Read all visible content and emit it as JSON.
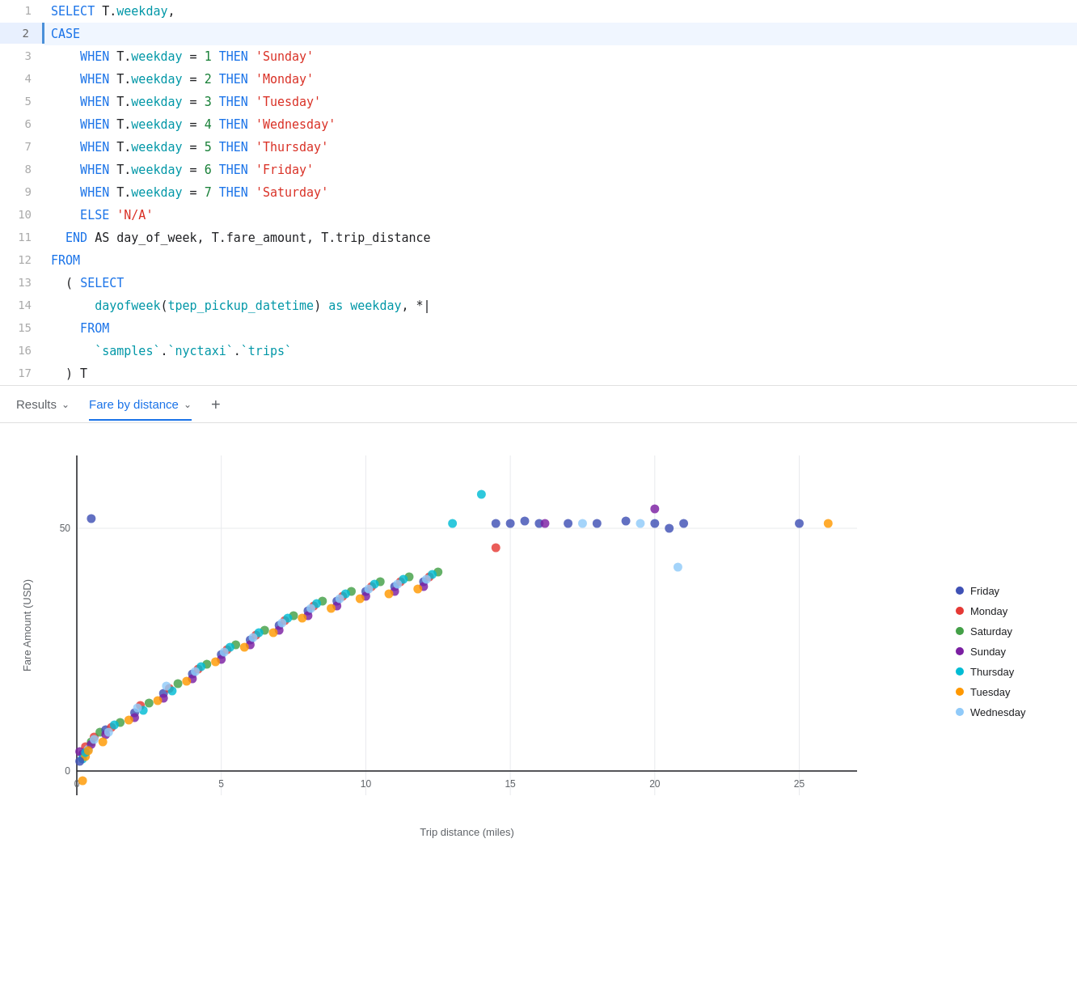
{
  "editor": {
    "lines": [
      {
        "num": 1,
        "active": false,
        "tokens": [
          {
            "text": "SELECT ",
            "cls": "kw-blue"
          },
          {
            "text": "T.",
            "cls": "kw-black"
          },
          {
            "text": "weekday",
            "cls": "kw-cyan"
          },
          {
            "text": ",",
            "cls": "kw-black"
          }
        ]
      },
      {
        "num": 2,
        "active": true,
        "tokens": [
          {
            "text": "CASE",
            "cls": "kw-blue"
          }
        ]
      },
      {
        "num": 3,
        "active": false,
        "tokens": [
          {
            "text": "    WHEN ",
            "cls": "kw-blue"
          },
          {
            "text": "T.",
            "cls": "kw-black"
          },
          {
            "text": "weekday",
            "cls": "kw-cyan"
          },
          {
            "text": " = ",
            "cls": "kw-black"
          },
          {
            "text": "1",
            "cls": "kw-green"
          },
          {
            "text": " THEN ",
            "cls": "kw-blue"
          },
          {
            "text": "'Sunday'",
            "cls": "kw-red"
          }
        ]
      },
      {
        "num": 4,
        "active": false,
        "tokens": [
          {
            "text": "    WHEN ",
            "cls": "kw-blue"
          },
          {
            "text": "T.",
            "cls": "kw-black"
          },
          {
            "text": "weekday",
            "cls": "kw-cyan"
          },
          {
            "text": " = ",
            "cls": "kw-black"
          },
          {
            "text": "2",
            "cls": "kw-green"
          },
          {
            "text": " THEN ",
            "cls": "kw-blue"
          },
          {
            "text": "'Monday'",
            "cls": "kw-red"
          }
        ]
      },
      {
        "num": 5,
        "active": false,
        "tokens": [
          {
            "text": "    WHEN ",
            "cls": "kw-blue"
          },
          {
            "text": "T.",
            "cls": "kw-black"
          },
          {
            "text": "weekday",
            "cls": "kw-cyan"
          },
          {
            "text": " = ",
            "cls": "kw-black"
          },
          {
            "text": "3",
            "cls": "kw-green"
          },
          {
            "text": " THEN ",
            "cls": "kw-blue"
          },
          {
            "text": "'Tuesday'",
            "cls": "kw-red"
          }
        ]
      },
      {
        "num": 6,
        "active": false,
        "tokens": [
          {
            "text": "    WHEN ",
            "cls": "kw-blue"
          },
          {
            "text": "T.",
            "cls": "kw-black"
          },
          {
            "text": "weekday",
            "cls": "kw-cyan"
          },
          {
            "text": " = ",
            "cls": "kw-black"
          },
          {
            "text": "4",
            "cls": "kw-green"
          },
          {
            "text": " THEN ",
            "cls": "kw-blue"
          },
          {
            "text": "'Wednesday'",
            "cls": "kw-red"
          }
        ]
      },
      {
        "num": 7,
        "active": false,
        "tokens": [
          {
            "text": "    WHEN ",
            "cls": "kw-blue"
          },
          {
            "text": "T.",
            "cls": "kw-black"
          },
          {
            "text": "weekday",
            "cls": "kw-cyan"
          },
          {
            "text": " = ",
            "cls": "kw-black"
          },
          {
            "text": "5",
            "cls": "kw-green"
          },
          {
            "text": " THEN ",
            "cls": "kw-blue"
          },
          {
            "text": "'Thursday'",
            "cls": "kw-red"
          }
        ]
      },
      {
        "num": 8,
        "active": false,
        "tokens": [
          {
            "text": "    WHEN ",
            "cls": "kw-blue"
          },
          {
            "text": "T.",
            "cls": "kw-black"
          },
          {
            "text": "weekday",
            "cls": "kw-cyan"
          },
          {
            "text": " = ",
            "cls": "kw-black"
          },
          {
            "text": "6",
            "cls": "kw-green"
          },
          {
            "text": " THEN ",
            "cls": "kw-blue"
          },
          {
            "text": "'Friday'",
            "cls": "kw-red"
          }
        ]
      },
      {
        "num": 9,
        "active": false,
        "tokens": [
          {
            "text": "    WHEN ",
            "cls": "kw-blue"
          },
          {
            "text": "T.",
            "cls": "kw-black"
          },
          {
            "text": "weekday",
            "cls": "kw-cyan"
          },
          {
            "text": " = ",
            "cls": "kw-black"
          },
          {
            "text": "7",
            "cls": "kw-green"
          },
          {
            "text": " THEN ",
            "cls": "kw-blue"
          },
          {
            "text": "'Saturday'",
            "cls": "kw-red"
          }
        ]
      },
      {
        "num": 10,
        "active": false,
        "tokens": [
          {
            "text": "    ELSE ",
            "cls": "kw-blue"
          },
          {
            "text": "'N/A'",
            "cls": "kw-red"
          }
        ]
      },
      {
        "num": 11,
        "active": false,
        "tokens": [
          {
            "text": "  END ",
            "cls": "kw-blue"
          },
          {
            "text": "AS ",
            "cls": "kw-black"
          },
          {
            "text": "day_of_week, T.fare_amount, T.trip_distance",
            "cls": "kw-black"
          }
        ]
      },
      {
        "num": 12,
        "active": false,
        "tokens": [
          {
            "text": "FROM",
            "cls": "kw-blue"
          }
        ]
      },
      {
        "num": 13,
        "active": false,
        "tokens": [
          {
            "text": "  ( ",
            "cls": "kw-black"
          },
          {
            "text": "SELECT",
            "cls": "kw-blue"
          }
        ]
      },
      {
        "num": 14,
        "active": false,
        "tokens": [
          {
            "text": "      ",
            "cls": "kw-black"
          },
          {
            "text": "dayofweek",
            "cls": "kw-cyan"
          },
          {
            "text": "(",
            "cls": "kw-black"
          },
          {
            "text": "tpep_pickup_datetime",
            "cls": "kw-cyan"
          },
          {
            "text": ") ",
            "cls": "kw-black"
          },
          {
            "text": "as ",
            "cls": "kw-cyan"
          },
          {
            "text": "weekday",
            "cls": "kw-cyan"
          },
          {
            "text": ", *",
            "cls": "kw-black"
          },
          {
            "text": "|",
            "cls": "kw-black"
          }
        ]
      },
      {
        "num": 15,
        "active": false,
        "tokens": [
          {
            "text": "    FROM",
            "cls": "kw-blue"
          }
        ]
      },
      {
        "num": 16,
        "active": false,
        "tokens": [
          {
            "text": "      ",
            "cls": "kw-black"
          },
          {
            "text": "`samples`",
            "cls": "kw-cyan"
          },
          {
            "text": ".",
            "cls": "kw-black"
          },
          {
            "text": "`nyctaxi`",
            "cls": "kw-cyan"
          },
          {
            "text": ".",
            "cls": "kw-black"
          },
          {
            "text": "`trips`",
            "cls": "kw-cyan"
          }
        ]
      },
      {
        "num": 17,
        "active": false,
        "tokens": [
          {
            "text": "  ) T",
            "cls": "kw-black"
          }
        ]
      }
    ]
  },
  "tabs": {
    "results_label": "Results",
    "fare_by_distance_label": "Fare by distance",
    "add_label": "+"
  },
  "chart": {
    "y_axis_label": "Fare Amount (USD)",
    "x_axis_label": "Trip distance (miles)",
    "y_ticks": [
      "0",
      "50"
    ],
    "x_ticks": [
      "0",
      "5",
      "10",
      "15",
      "20",
      "25"
    ],
    "legend": [
      {
        "label": "Friday",
        "color": "#3f51b5"
      },
      {
        "label": "Monday",
        "color": "#e53935"
      },
      {
        "label": "Saturday",
        "color": "#43a047"
      },
      {
        "label": "Sunday",
        "color": "#7b1fa2"
      },
      {
        "label": "Thursday",
        "color": "#00bcd4"
      },
      {
        "label": "Tuesday",
        "color": "#ff9800"
      },
      {
        "label": "Wednesday",
        "color": "#90caf9"
      }
    ],
    "scatter_points": [
      {
        "x": 0.2,
        "y": 3.5,
        "day": "Friday"
      },
      {
        "x": 0.3,
        "y": 5.0,
        "day": "Monday"
      },
      {
        "x": 0.5,
        "y": 6.0,
        "day": "Saturday"
      },
      {
        "x": 0.1,
        "y": 4.0,
        "day": "Sunday"
      },
      {
        "x": 0.2,
        "y": 2.5,
        "day": "Thursday"
      },
      {
        "x": 0.3,
        "y": 3.0,
        "day": "Tuesday"
      },
      {
        "x": 0.4,
        "y": 4.5,
        "day": "Wednesday"
      },
      {
        "x": 0.1,
        "y": 2.0,
        "day": "Friday"
      },
      {
        "x": 0.6,
        "y": 7.0,
        "day": "Monday"
      },
      {
        "x": 0.8,
        "y": 8.0,
        "day": "Saturday"
      },
      {
        "x": 0.5,
        "y": 5.5,
        "day": "Sunday"
      },
      {
        "x": 0.3,
        "y": 3.8,
        "day": "Thursday"
      },
      {
        "x": 0.4,
        "y": 4.2,
        "day": "Tuesday"
      },
      {
        "x": 0.6,
        "y": 6.5,
        "day": "Wednesday"
      },
      {
        "x": 1.0,
        "y": 8.5,
        "day": "Friday"
      },
      {
        "x": 1.2,
        "y": 9.0,
        "day": "Monday"
      },
      {
        "x": 1.5,
        "y": 10.0,
        "day": "Saturday"
      },
      {
        "x": 1.0,
        "y": 7.5,
        "day": "Sunday"
      },
      {
        "x": 1.3,
        "y": 9.5,
        "day": "Thursday"
      },
      {
        "x": 0.9,
        "y": 6.0,
        "day": "Tuesday"
      },
      {
        "x": 1.1,
        "y": 8.0,
        "day": "Wednesday"
      },
      {
        "x": 0.5,
        "y": 52,
        "day": "Friday"
      },
      {
        "x": 0.2,
        "y": -2,
        "day": "Tuesday"
      },
      {
        "x": 2.0,
        "y": 12.0,
        "day": "Friday"
      },
      {
        "x": 2.2,
        "y": 13.5,
        "day": "Monday"
      },
      {
        "x": 2.5,
        "y": 14.0,
        "day": "Saturday"
      },
      {
        "x": 2.0,
        "y": 11.0,
        "day": "Sunday"
      },
      {
        "x": 2.3,
        "y": 12.5,
        "day": "Thursday"
      },
      {
        "x": 1.8,
        "y": 10.5,
        "day": "Tuesday"
      },
      {
        "x": 2.1,
        "y": 13.0,
        "day": "Wednesday"
      },
      {
        "x": 3.0,
        "y": 16.0,
        "day": "Friday"
      },
      {
        "x": 3.2,
        "y": 17.0,
        "day": "Monday"
      },
      {
        "x": 3.5,
        "y": 18.0,
        "day": "Saturday"
      },
      {
        "x": 3.0,
        "y": 15.0,
        "day": "Sunday"
      },
      {
        "x": 3.3,
        "y": 16.5,
        "day": "Thursday"
      },
      {
        "x": 2.8,
        "y": 14.5,
        "day": "Tuesday"
      },
      {
        "x": 3.1,
        "y": 17.5,
        "day": "Wednesday"
      },
      {
        "x": 4.0,
        "y": 20.0,
        "day": "Friday"
      },
      {
        "x": 4.2,
        "y": 21.0,
        "day": "Monday"
      },
      {
        "x": 4.5,
        "y": 22.0,
        "day": "Saturday"
      },
      {
        "x": 4.0,
        "y": 19.0,
        "day": "Sunday"
      },
      {
        "x": 4.3,
        "y": 21.5,
        "day": "Thursday"
      },
      {
        "x": 3.8,
        "y": 18.5,
        "day": "Tuesday"
      },
      {
        "x": 4.1,
        "y": 20.5,
        "day": "Wednesday"
      },
      {
        "x": 5.0,
        "y": 24.0,
        "day": "Friday"
      },
      {
        "x": 5.2,
        "y": 25.0,
        "day": "Monday"
      },
      {
        "x": 5.5,
        "y": 26.0,
        "day": "Saturday"
      },
      {
        "x": 5.0,
        "y": 23.0,
        "day": "Sunday"
      },
      {
        "x": 5.3,
        "y": 25.5,
        "day": "Thursday"
      },
      {
        "x": 4.8,
        "y": 22.5,
        "day": "Tuesday"
      },
      {
        "x": 5.1,
        "y": 24.5,
        "day": "Wednesday"
      },
      {
        "x": 6.0,
        "y": 27.0,
        "day": "Friday"
      },
      {
        "x": 6.2,
        "y": 28.0,
        "day": "Monday"
      },
      {
        "x": 6.5,
        "y": 29.0,
        "day": "Saturday"
      },
      {
        "x": 6.0,
        "y": 26.0,
        "day": "Sunday"
      },
      {
        "x": 6.3,
        "y": 28.5,
        "day": "Thursday"
      },
      {
        "x": 5.8,
        "y": 25.5,
        "day": "Tuesday"
      },
      {
        "x": 6.1,
        "y": 27.5,
        "day": "Wednesday"
      },
      {
        "x": 7.0,
        "y": 30.0,
        "day": "Friday"
      },
      {
        "x": 7.2,
        "y": 31.0,
        "day": "Monday"
      },
      {
        "x": 7.5,
        "y": 32.0,
        "day": "Saturday"
      },
      {
        "x": 7.0,
        "y": 29.0,
        "day": "Sunday"
      },
      {
        "x": 7.3,
        "y": 31.5,
        "day": "Thursday"
      },
      {
        "x": 6.8,
        "y": 28.5,
        "day": "Tuesday"
      },
      {
        "x": 7.1,
        "y": 30.5,
        "day": "Wednesday"
      },
      {
        "x": 8.0,
        "y": 33.0,
        "day": "Friday"
      },
      {
        "x": 8.2,
        "y": 34.0,
        "day": "Monday"
      },
      {
        "x": 8.5,
        "y": 35.0,
        "day": "Saturday"
      },
      {
        "x": 8.0,
        "y": 32.0,
        "day": "Sunday"
      },
      {
        "x": 8.3,
        "y": 34.5,
        "day": "Thursday"
      },
      {
        "x": 7.8,
        "y": 31.5,
        "day": "Tuesday"
      },
      {
        "x": 8.1,
        "y": 33.5,
        "day": "Wednesday"
      },
      {
        "x": 9.0,
        "y": 35.0,
        "day": "Friday"
      },
      {
        "x": 9.2,
        "y": 36.0,
        "day": "Monday"
      },
      {
        "x": 9.5,
        "y": 37.0,
        "day": "Saturday"
      },
      {
        "x": 9.0,
        "y": 34.0,
        "day": "Sunday"
      },
      {
        "x": 9.3,
        "y": 36.5,
        "day": "Thursday"
      },
      {
        "x": 8.8,
        "y": 33.5,
        "day": "Tuesday"
      },
      {
        "x": 9.1,
        "y": 35.5,
        "day": "Wednesday"
      },
      {
        "x": 10.0,
        "y": 37.0,
        "day": "Friday"
      },
      {
        "x": 10.2,
        "y": 38.0,
        "day": "Monday"
      },
      {
        "x": 10.5,
        "y": 39.0,
        "day": "Saturday"
      },
      {
        "x": 10.0,
        "y": 36.0,
        "day": "Sunday"
      },
      {
        "x": 10.3,
        "y": 38.5,
        "day": "Thursday"
      },
      {
        "x": 9.8,
        "y": 35.5,
        "day": "Tuesday"
      },
      {
        "x": 10.1,
        "y": 37.5,
        "day": "Wednesday"
      },
      {
        "x": 11.0,
        "y": 38.0,
        "day": "Friday"
      },
      {
        "x": 11.2,
        "y": 39.0,
        "day": "Monday"
      },
      {
        "x": 11.5,
        "y": 40.0,
        "day": "Saturday"
      },
      {
        "x": 11.0,
        "y": 37.0,
        "day": "Sunday"
      },
      {
        "x": 11.3,
        "y": 39.5,
        "day": "Thursday"
      },
      {
        "x": 10.8,
        "y": 36.5,
        "day": "Tuesday"
      },
      {
        "x": 11.1,
        "y": 38.5,
        "day": "Wednesday"
      },
      {
        "x": 12.0,
        "y": 39.0,
        "day": "Friday"
      },
      {
        "x": 12.2,
        "y": 40.0,
        "day": "Monday"
      },
      {
        "x": 12.5,
        "y": 41.0,
        "day": "Saturday"
      },
      {
        "x": 12.0,
        "y": 38.0,
        "day": "Sunday"
      },
      {
        "x": 12.3,
        "y": 40.5,
        "day": "Thursday"
      },
      {
        "x": 11.8,
        "y": 37.5,
        "day": "Tuesday"
      },
      {
        "x": 12.1,
        "y": 39.5,
        "day": "Wednesday"
      },
      {
        "x": 13.0,
        "y": 51.0,
        "day": "Thursday"
      },
      {
        "x": 14.0,
        "y": 57.0,
        "day": "Thursday"
      },
      {
        "x": 14.5,
        "y": 51.0,
        "day": "Friday"
      },
      {
        "x": 15.0,
        "y": 51.0,
        "day": "Friday"
      },
      {
        "x": 15.5,
        "y": 51.5,
        "day": "Friday"
      },
      {
        "x": 16.0,
        "y": 51.0,
        "day": "Friday"
      },
      {
        "x": 16.2,
        "y": 51.0,
        "day": "Sunday"
      },
      {
        "x": 17.0,
        "y": 51.0,
        "day": "Friday"
      },
      {
        "x": 17.5,
        "y": 51.0,
        "day": "Wednesday"
      },
      {
        "x": 18.0,
        "y": 51.0,
        "day": "Friday"
      },
      {
        "x": 14.5,
        "y": 46.0,
        "day": "Monday"
      },
      {
        "x": 19.0,
        "y": 51.5,
        "day": "Friday"
      },
      {
        "x": 19.5,
        "y": 51.0,
        "day": "Wednesday"
      },
      {
        "x": 20.0,
        "y": 51.0,
        "day": "Friday"
      },
      {
        "x": 20.0,
        "y": 54.0,
        "day": "Sunday"
      },
      {
        "x": 20.5,
        "y": 50.0,
        "day": "Friday"
      },
      {
        "x": 20.8,
        "y": 42.0,
        "day": "Wednesday"
      },
      {
        "x": 21.0,
        "y": 51.0,
        "day": "Friday"
      },
      {
        "x": 25.0,
        "y": 51.0,
        "day": "Friday"
      },
      {
        "x": 26.0,
        "y": 51.0,
        "day": "Tuesday"
      }
    ]
  }
}
